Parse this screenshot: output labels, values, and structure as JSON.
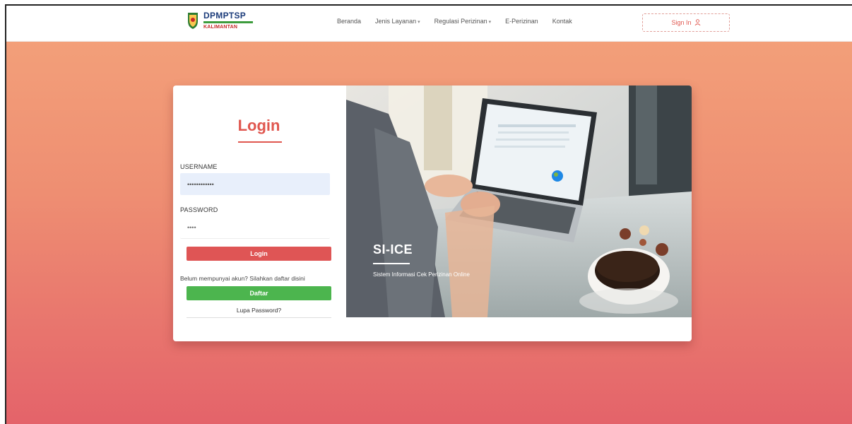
{
  "header": {
    "logo_title": "DPMPTSP",
    "logo_sub": "KALIMANTAN",
    "nav": [
      {
        "label": "Beranda"
      },
      {
        "label": "Jenis Layanan"
      },
      {
        "label": "Regulasi Perizinan"
      },
      {
        "label": "E-Perizinan"
      },
      {
        "label": "Kontak"
      }
    ],
    "signin_label": "Sign In"
  },
  "login": {
    "heading": "Login",
    "username_label": "USERNAME",
    "username_value": "••••••••••••",
    "password_label": "PASSWORD",
    "password_placeholder": "••••",
    "login_button": "Login",
    "register_prompt": "Belum mempunyai akun? Silahkan daftar disini",
    "register_button": "Daftar",
    "forgot_link": "Lupa Password?"
  },
  "hero": {
    "title": "SI-ICE",
    "subtitle": "Sistem Informasi Cek Perizinan Online"
  },
  "colors": {
    "accent": "#e0574f",
    "register": "#4cb54e",
    "bg_top": "#f4a37b",
    "bg_bottom": "#e4636a"
  }
}
